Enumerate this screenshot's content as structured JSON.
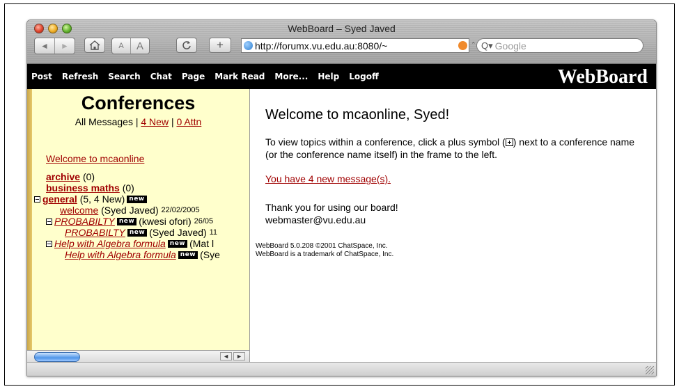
{
  "window": {
    "title": "WebBoard – Syed Javed"
  },
  "toolbar": {
    "back_label": "◄",
    "forward_label": "►",
    "home_icon": "home-icon",
    "font_small": "A",
    "font_large": "A",
    "reload_icon": "reload-icon",
    "add_label": "+",
    "url": "http://forumx.vu.edu.au:8080/~",
    "search_placeholder": "Google"
  },
  "nav": {
    "items": [
      "Post",
      "Refresh",
      "Search",
      "Chat",
      "Page",
      "Mark Read",
      "More...",
      "Help",
      "Logoff"
    ],
    "brand": "WebBoard"
  },
  "left": {
    "title": "Conferences",
    "subtitle": {
      "all": "All Messages",
      "sep": "|",
      "new_link": "4 New",
      "attn_link": "0 Attn"
    },
    "welcome_link": "Welcome to mcaonline",
    "tree": {
      "archive": {
        "label": "archive",
        "count": "(0)"
      },
      "business": {
        "label": "business maths",
        "count": "(0)"
      },
      "general": {
        "label": "general",
        "count": "(5, 4 New)",
        "badge": "new"
      },
      "welcome": {
        "label": "welcome",
        "author": "(Syed Javed)",
        "date": "22/02/2005"
      },
      "prob1": {
        "label": "PROBABILTY",
        "badge": "new",
        "author": "(kwesi ofori)",
        "date": "26/05"
      },
      "prob2": {
        "label": "PROBABILTY",
        "badge": "new",
        "author": "(Syed Javed)",
        "date": "11"
      },
      "alg1": {
        "label": "Help with Algebra formula",
        "badge": "new",
        "author": "(Mat l"
      },
      "alg2": {
        "label": "Help with Algebra formula",
        "badge": "new",
        "author": "(Sye"
      }
    }
  },
  "right": {
    "title": "Welcome to mcaonline, Syed!",
    "instr_before": "To view topics within a conference, click a plus symbol (",
    "instr_after": ") next to a conference name (or the conference name itself) in the frame to the left.",
    "new_messages": "You have 4 new message(s).",
    "thanks": "Thank you for using our board!",
    "email": "webmaster@vu.edu.au",
    "copyright1": "WebBoard 5.0.208 ©2001 ChatSpace, Inc.",
    "copyright2": "WebBoard is a trademark of ChatSpace, Inc."
  }
}
